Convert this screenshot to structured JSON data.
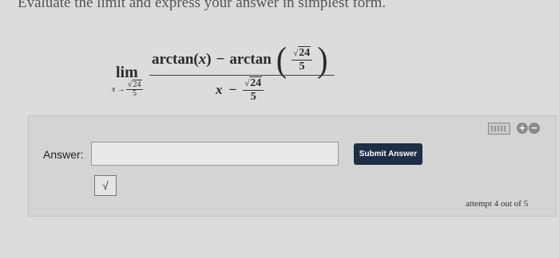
{
  "instruction": "Evaluate the limit and express your answer in simplest form.",
  "problem": {
    "lim_word": "lim",
    "lim_var": "x",
    "arrow": "→",
    "sqrt_value": "24",
    "denominator_value": "5",
    "numerator_func1": "arctan(",
    "numerator_var": "x",
    "numerator_close": ")",
    "minus": "−",
    "numerator_func2": "arctan",
    "denom_var": "x"
  },
  "answer": {
    "label": "Answer:",
    "input_value": "",
    "submit_label": "Submit Answer",
    "sqrt_button": "√",
    "attempt_text": "attempt 4 out of 5"
  },
  "icons": {
    "keyboard": "keyboard-icon",
    "plus": "+",
    "minus": "−"
  },
  "colors": {
    "submit_bg": "#1d2e45",
    "panel_bg": "#d4d4d4"
  }
}
